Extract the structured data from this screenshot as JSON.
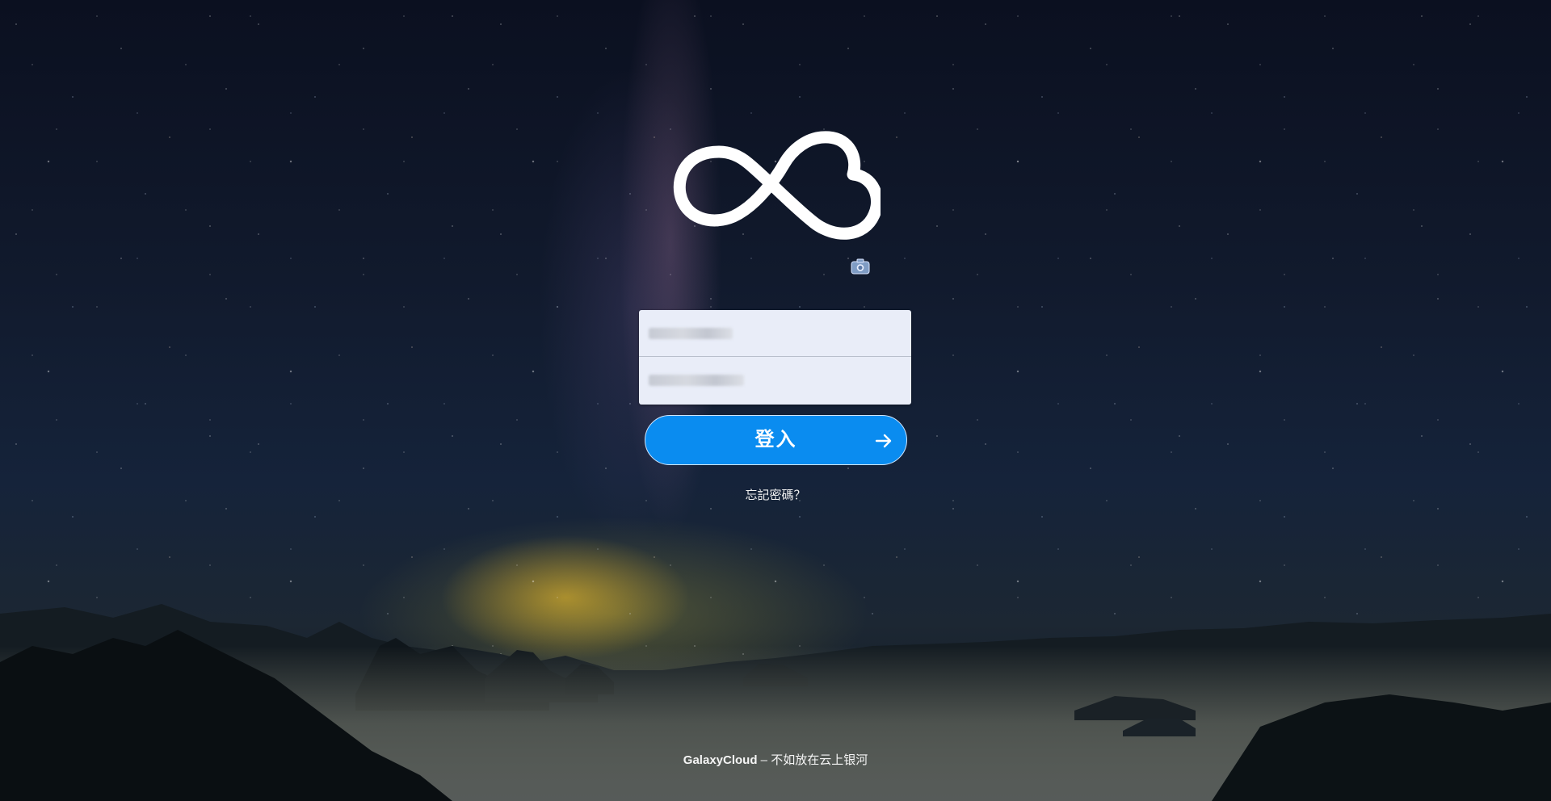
{
  "login_form": {
    "username_placeholder": "",
    "password_placeholder": "",
    "login_button_label": "登入",
    "forgot_password_link": "忘記密碼？"
  },
  "footer": {
    "brand": "GalaxyCloud",
    "separator": " – ",
    "tagline": "不如放在云上银河"
  },
  "colors": {
    "login_button": "#0a8cf0",
    "form_background": "#e9edf8"
  },
  "icons": {
    "logo": "cloud-infinity-logo",
    "camera": "camera-icon",
    "arrow": "arrow-right-icon"
  }
}
